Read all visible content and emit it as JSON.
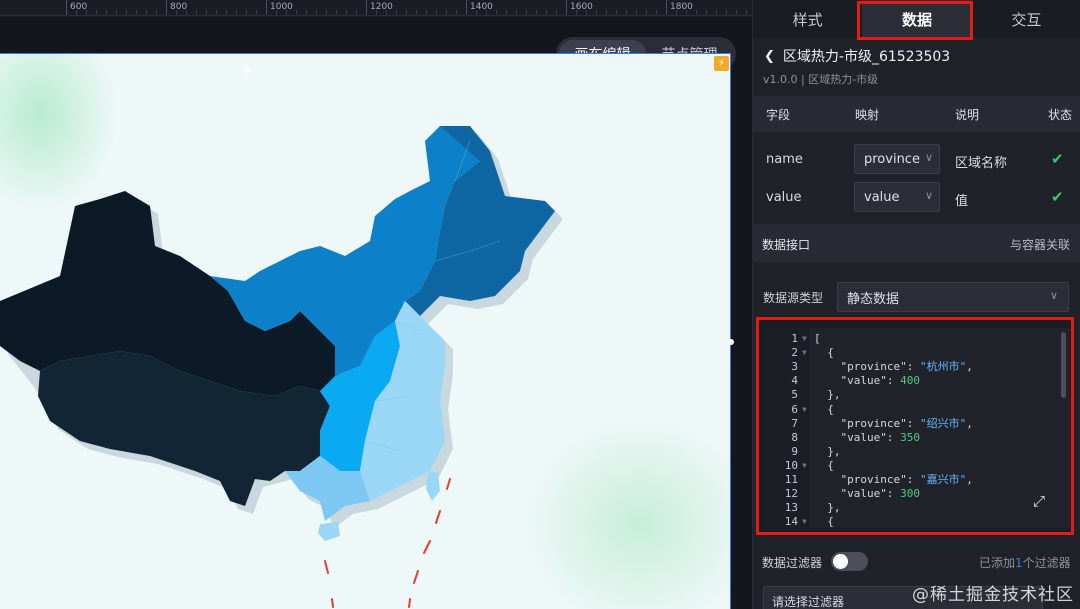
{
  "ruler": {
    "labels": [
      "600",
      "800",
      "1000",
      "1200",
      "1400",
      "1600",
      "1800"
    ]
  },
  "canvas": {
    "mode_tabs": [
      "画布编辑",
      "节点管理"
    ]
  },
  "panel": {
    "tabs": [
      "样式",
      "数据",
      "交互"
    ],
    "component_title": "区域热力-市级_61523503",
    "component_subtitle": "v1.0.0 | 区域热力-市级",
    "field_headers": [
      "字段",
      "映射",
      "说明",
      "状态"
    ],
    "fields": [
      {
        "name": "name",
        "mapping": "province",
        "desc": "区域名称"
      },
      {
        "name": "value",
        "mapping": "value",
        "desc": "值"
      }
    ],
    "data_interface_label": "数据接口",
    "container_link_label": "与容器关联",
    "datasource_type_label": "数据源类型",
    "datasource_type_value": "静态数据",
    "code_lines": [
      "[",
      "  {",
      "    \"province\": \"杭州市\",",
      "    \"value\": 400",
      "  },",
      "  {",
      "    \"province\": \"绍兴市\",",
      "    \"value\": 350",
      "  },",
      "  {",
      "    \"province\": \"嘉兴市\",",
      "    \"value\": 300",
      "  },",
      "  {"
    ],
    "filter_label": "数据过滤器",
    "filter_added_prefix": "已添加",
    "filter_added_count": "1",
    "filter_added_suffix": "个过滤器",
    "filter_select_placeholder": "请选择过滤器"
  },
  "watermark": "@稀土掘金技术社区",
  "colors": {
    "highlight": "#e31b1b",
    "region_darkest": "#0b1a26",
    "region_dark": "#0e6aa8",
    "region_mid": "#0a8fdc",
    "region_light": "#0aaaf2",
    "region_lightest": "#9ad7f7",
    "check": "#3cc56b"
  }
}
